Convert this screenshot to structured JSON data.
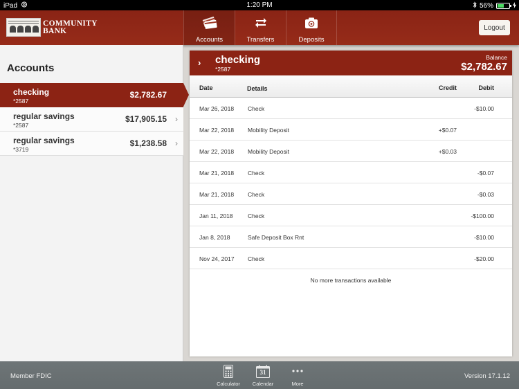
{
  "status_bar": {
    "device": "iPad",
    "time": "1:20 PM",
    "battery_percent": "56%",
    "battery_level": 0.56
  },
  "header": {
    "logo_line1": "COMMUNITY",
    "logo_line2": "BANK",
    "tabs": [
      {
        "label": "Accounts",
        "icon": "credit-cards-icon",
        "active": true
      },
      {
        "label": "Transfers",
        "icon": "transfer-arrows-icon",
        "active": false
      },
      {
        "label": "Deposits",
        "icon": "camera-icon",
        "active": false
      }
    ],
    "logout_label": "Logout",
    "accent_color": "#8c2314"
  },
  "sidebar": {
    "title": "Accounts",
    "accounts": [
      {
        "name": "checking",
        "number": "*2587",
        "balance": "$2,782.67",
        "active": true
      },
      {
        "name": "regular savings",
        "number": "*2587",
        "balance": "$17,905.15",
        "active": false
      },
      {
        "name": "regular savings",
        "number": "*3719",
        "balance": "$1,238.58",
        "active": false
      }
    ]
  },
  "detail": {
    "account_name": "checking",
    "account_number": "*2587",
    "balance_label": "Balance",
    "balance": "$2,782.67",
    "columns": {
      "date": "Date",
      "details": "Details",
      "credit": "Credit",
      "debit": "Debit"
    },
    "transactions": [
      {
        "date": "Mar 26, 2018",
        "details": "Check",
        "credit": "",
        "debit": "-$10.00"
      },
      {
        "date": "Mar 22, 2018",
        "details": "Mobility Deposit",
        "credit": "+$0.07",
        "debit": ""
      },
      {
        "date": "Mar 22, 2018",
        "details": "Mobility Deposit",
        "credit": "+$0.03",
        "debit": ""
      },
      {
        "date": "Mar 21, 2018",
        "details": "Check",
        "credit": "",
        "debit": "-$0.07"
      },
      {
        "date": "Mar 21, 2018",
        "details": "Check",
        "credit": "",
        "debit": "-$0.03"
      },
      {
        "date": "Jan 11, 2018",
        "details": "Check",
        "credit": "",
        "debit": "-$100.00"
      },
      {
        "date": "Jan 8, 2018",
        "details": "Safe Deposit Box Rnt",
        "credit": "",
        "debit": "-$10.00"
      },
      {
        "date": "Nov 24, 2017",
        "details": "Check",
        "credit": "",
        "debit": "-$20.00"
      }
    ],
    "no_more_text": "No more transactions available"
  },
  "footer": {
    "member_text": "Member FDIC",
    "version_text": "Version 17.1.12",
    "tools": [
      {
        "label": "Calculator",
        "icon": "calculator-icon"
      },
      {
        "label": "Calendar",
        "icon": "calendar-icon",
        "day": "31"
      },
      {
        "label": "More",
        "icon": "more-dots-icon"
      }
    ]
  }
}
